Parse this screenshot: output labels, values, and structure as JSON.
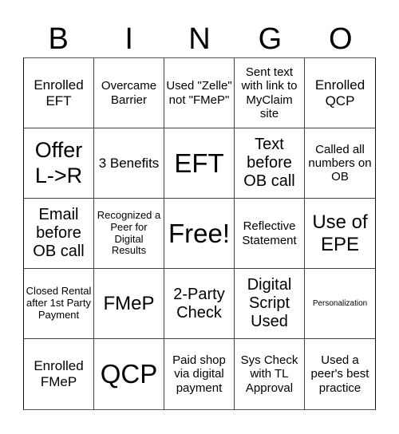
{
  "header": [
    "B",
    "I",
    "N",
    "G",
    "O"
  ],
  "cells": [
    {
      "text": "Enrolled EFT",
      "size": "s-lg"
    },
    {
      "text": "Overcame Barrier",
      "size": "s-md"
    },
    {
      "text": "Used \"Zelle\" not \"FMeP\"",
      "size": "s-md"
    },
    {
      "text": "Sent text with link to MyClaim site",
      "size": "s-md"
    },
    {
      "text": "Enrolled QCP",
      "size": "s-lg"
    },
    {
      "text": "Offer L->R",
      "size": "s-3xl"
    },
    {
      "text": "3 Benefits",
      "size": "s-lg"
    },
    {
      "text": "EFT",
      "size": "s-4xl"
    },
    {
      "text": "Text before OB call",
      "size": "s-xl"
    },
    {
      "text": "Called all numbers on OB",
      "size": "s-md"
    },
    {
      "text": "Email before OB call",
      "size": "s-xl"
    },
    {
      "text": "Recognized a Peer for Digital Results",
      "size": "s-sm"
    },
    {
      "text": "Free!",
      "size": "s-4xl"
    },
    {
      "text": "Reflective Statement",
      "size": "s-md"
    },
    {
      "text": "Use of EPE",
      "size": "s-2xl"
    },
    {
      "text": "Closed Rental after 1st Party Payment",
      "size": "s-sm"
    },
    {
      "text": "FMeP",
      "size": "s-2xl"
    },
    {
      "text": "2-Party Check",
      "size": "s-xl"
    },
    {
      "text": "Digital Script Used",
      "size": "s-xl"
    },
    {
      "text": "Personalization",
      "size": "s-xs"
    },
    {
      "text": "Enrolled FMeP",
      "size": "s-lg"
    },
    {
      "text": "QCP",
      "size": "s-4xl"
    },
    {
      "text": "Paid shop via digital payment",
      "size": "s-md"
    },
    {
      "text": "Sys Check with TL Approval",
      "size": "s-md"
    },
    {
      "text": "Used a peer's best practice",
      "size": "s-md"
    }
  ]
}
